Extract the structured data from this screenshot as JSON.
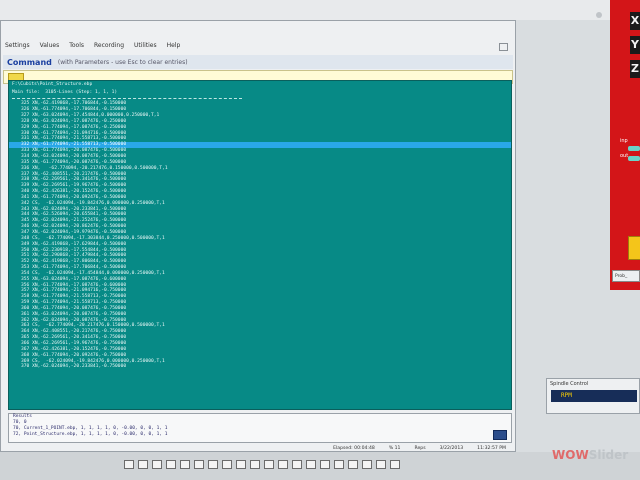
{
  "menu": [
    "Settings",
    "Values",
    "Tools",
    "Recording",
    "Utilities",
    "Help"
  ],
  "command": {
    "title": "Command",
    "hint": "(with Parameters - use Esc to clear entries)"
  },
  "console": {
    "path": "F:\\Cubits\\Point_Structure.ebp",
    "main_file": "Main file:  3105-Lines (Step: 1, 1, 1)",
    "lines": [
      "325 XN,-62.419868,-17.706844,-0.150000",
      "326 XN,-61.774094,-17.706844,-0.150000",
      "327 XN,-63.024094,-17.454844,0.000000,0.250000,T,1",
      "328 XN,-63.024094,-17.087476,-0.250000",
      "329 XN,-61.774094,-17.087476,-0.250000",
      "330 XN,-61.774094,-21.094716,-0.500000",
      "331 XN,-61.774094,-21.558713,-0.500000",
      "332 XN,-61.774094,-21.558713,-0.500000",
      "333 XN,-61.774094,-20.087476,-0.500000",
      "334 XN,-63.024094,-20.087476,-0.500000",
      "335 XN,-61.774094,-20.087476,-0.500000",
      "336 XN,   -62.774094,-20.217476,0.150000,0.500000,T,1",
      "337 XN,-62.408551,-20.217476,-0.500000",
      "338 XN,-62.269561,-20.341476,-0.500000",
      "339 XN,-62.269561,-19.967476,-0.500000",
      "340 XN,-62.426381,-20.152476,-0.500000",
      "341 XN,-61.774094,-20.092476,-0.500000",
      "342 CS,  -62.024094,-19.842476,0.000000,0.250000,T,1",
      "343 XN,-62.024094,-20.233841,-0.500000",
      "344 XN,-62.526094,-20.655841,-0.500000",
      "345 XN,-62.024094,-21.252476,-0.500000",
      "346 XN,-62.024094,-20.862476,-0.500000",
      "347 XN,-62.024094,-19.979476,-0.500000",
      "348 CS,  -62.774094,-17.303844,0.250000,0.500000,T,1",
      "349 XN,-62.419868,-17.629844,-0.500000",
      "350 XN,-62.230918,-17.554844,-0.500000",
      "351 XN,-62.290868,-17.479844,-0.500000",
      "352 XN,-62.419868,-17.806844,-0.500000",
      "353 XN,-61.774094,-17.706844,-0.500000",
      "354 CS,  -62.024094,-17.454844,0.000000,0.250000,T,1",
      "355 XN,-63.024094,-17.087476,-0.600000",
      "356 XN,-61.774094,-17.087476,-0.600000",
      "357 XN,-61.774094,-21.094716,-0.750000",
      "358 XN,-61.774094,-21.558713,-0.750000",
      "359 XN,-61.774094,-21.558713,-0.750000",
      "360 XN,-61.774094,-20.087476,-0.750000",
      "361 XN,-63.024094,-20.087476,-0.750000",
      "362 XN,-62.024094,-20.087476,-0.750000",
      "363 CS,  -62.774094,-20.217476,0.150000,0.500000,T,1",
      "364 XN,-62.408551,-20.217476,-0.750000",
      "365 XN,-62.269561,-20.341476,-0.750000",
      "366 XN,-62.269561,-19.967476,-0.750000",
      "367 XN,-62.426381,-20.152476,-0.750000",
      "368 XN,-61.774094,-20.092476,-0.750000",
      "369 CS,  -62.024094,-19.842476,0.000000,0.250000,T,1",
      "370 XN,-62.024094,-20.233841,-0.750000"
    ],
    "selected_index": 7
  },
  "output": {
    "label": "Results",
    "lines": [
      "70, 0",
      "70, Current_1_POINT.ebp, 1, 1, 1, 1, 0, -0.00, 0, 0, 1, 1",
      "72, Point_Structure.ebp, 1, 1, 1, 1, 0, -0.00, 0, 0, 1, 1"
    ]
  },
  "status": {
    "elapsed": "Elapsed: 00:04:48",
    "pct": "% 11",
    "reps": "Reps",
    "date": "3/22/2013",
    "time": "11:32:57 PM"
  },
  "panel": {
    "axes": [
      "X",
      "Y",
      "Z"
    ],
    "labels": [
      "inp",
      "out"
    ],
    "strip": "Prob_",
    "indicator_color": "#6bd3c8",
    "bg_color": "#d31518"
  },
  "spindle": {
    "title": "Spindle Control",
    "field": "RPM"
  },
  "watermark": {
    "part1": "WOW",
    "part2": "Slider"
  }
}
